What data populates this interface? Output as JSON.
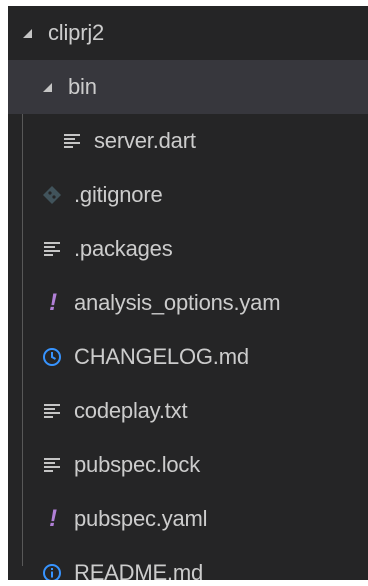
{
  "explorer": {
    "root": {
      "label": "cliprj2",
      "expanded": true
    },
    "folder_bin": {
      "label": "bin",
      "expanded": true
    },
    "items": [
      {
        "label": "server.dart",
        "icon": "lines-file-icon"
      },
      {
        "label": ".gitignore",
        "icon": "git-icon"
      },
      {
        "label": ".packages",
        "icon": "lines-file-icon"
      },
      {
        "label": "analysis_options.yam",
        "icon": "exclamation-icon"
      },
      {
        "label": "CHANGELOG.md",
        "icon": "clock-icon"
      },
      {
        "label": "codeplay.txt",
        "icon": "lines-file-icon"
      },
      {
        "label": "pubspec.lock",
        "icon": "lines-file-icon"
      },
      {
        "label": "pubspec.yaml",
        "icon": "exclamation-icon"
      },
      {
        "label": "README.md",
        "icon": "info-icon"
      }
    ]
  },
  "colors": {
    "background": "#252526",
    "selected_row": "#37373d",
    "text": "#cccccc",
    "yaml_icon": "#b180d7",
    "changelog_icon": "#3794ff",
    "readme_icon": "#3794ff",
    "gitignore_icon": "#41535b"
  }
}
